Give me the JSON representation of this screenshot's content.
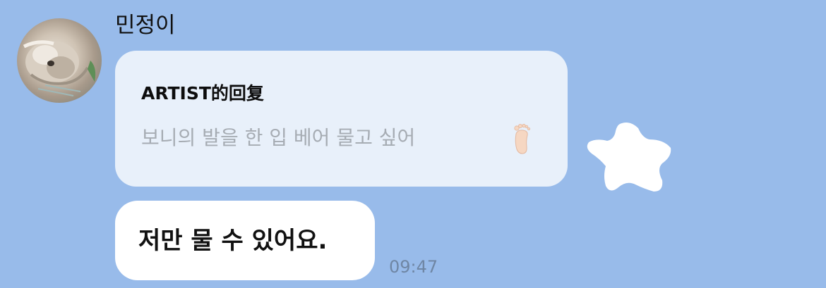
{
  "sender": {
    "name": "민정이",
    "avatar_icon": "dog-photo-avatar"
  },
  "reply": {
    "title": "ARTIST的回复",
    "text": "보니의 발을 한 입 베어 물고 싶어",
    "emoji_icon": "foot-icon"
  },
  "message": {
    "text": "저만 물 수 있어요.",
    "time": "09:47"
  },
  "sticker": {
    "icon": "white-star-sticker-icon"
  },
  "colors": {
    "background": "#98bbea",
    "reply_bubble": "#e8f0fa",
    "message_bubble": "#ffffff",
    "timestamp": "#6f86a4"
  }
}
